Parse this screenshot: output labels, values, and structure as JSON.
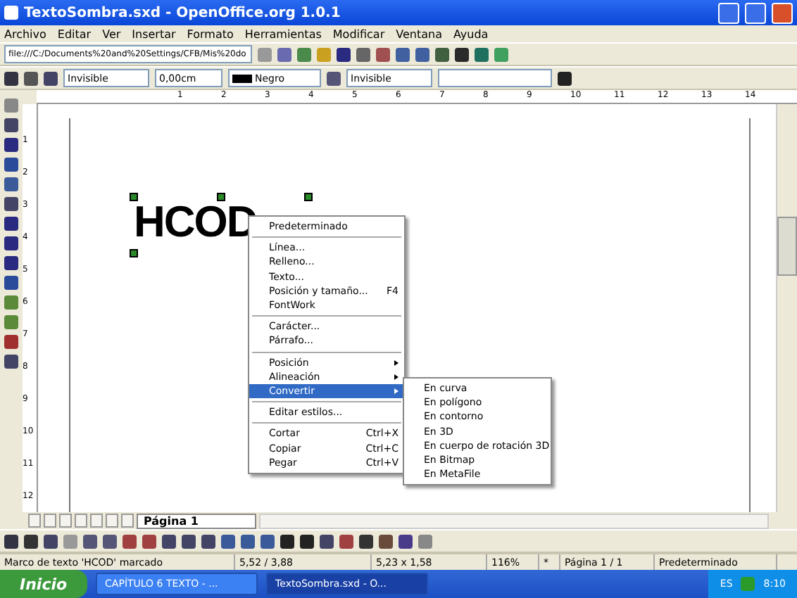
{
  "window": {
    "title": "TextoSombra.sxd - OpenOffice.org 1.0.1"
  },
  "menu": [
    "Archivo",
    "Editar",
    "Ver",
    "Insertar",
    "Formato",
    "Herramientas",
    "Modificar",
    "Ventana",
    "Ayuda"
  ],
  "url_field": {
    "value": "file:///C:/Documents%20and%20Settings/CFB/Mis%20do"
  },
  "line_bar": {
    "line_style": "Invisible",
    "line_width": "0,00cm",
    "line_color": "Negro",
    "area_style": "Invisible"
  },
  "ruler_h": [
    "1",
    "2",
    "3",
    "4",
    "5",
    "6",
    "7",
    "8",
    "9",
    "10",
    "11",
    "12",
    "13",
    "14"
  ],
  "ruler_v": [
    "1",
    "2",
    "3",
    "4",
    "5",
    "6",
    "7",
    "8",
    "9",
    "10",
    "11",
    "12"
  ],
  "drawing_text": "HCOD",
  "context_menu": [
    {
      "kind": "item",
      "label": "Predeterminado",
      "submenu": false,
      "selected": false
    },
    {
      "kind": "separator"
    },
    {
      "kind": "item",
      "label": "Línea...",
      "submenu": false,
      "selected": false
    },
    {
      "kind": "item",
      "label": "Relleno...",
      "submenu": false,
      "selected": false
    },
    {
      "kind": "item",
      "label": "Texto...",
      "submenu": false,
      "selected": false
    },
    {
      "kind": "item",
      "label": "Posición y tamaño...",
      "shortcut": "F4",
      "submenu": false,
      "selected": false
    },
    {
      "kind": "item",
      "label": "FontWork",
      "submenu": false,
      "selected": false
    },
    {
      "kind": "separator"
    },
    {
      "kind": "item",
      "label": "Carácter...",
      "submenu": false,
      "selected": false
    },
    {
      "kind": "item",
      "label": "Párrafo...",
      "submenu": false,
      "selected": false
    },
    {
      "kind": "separator"
    },
    {
      "kind": "item",
      "label": "Posición",
      "submenu": true,
      "selected": false
    },
    {
      "kind": "item",
      "label": "Alineación",
      "submenu": true,
      "selected": false
    },
    {
      "kind": "item",
      "label": "Convertir",
      "submenu": true,
      "selected": true
    },
    {
      "kind": "separator"
    },
    {
      "kind": "item",
      "label": "Editar estilos...",
      "submenu": false,
      "selected": false
    },
    {
      "kind": "separator"
    },
    {
      "kind": "item",
      "label": "Cortar",
      "shortcut": "Ctrl+X",
      "submenu": false,
      "selected": false
    },
    {
      "kind": "item",
      "label": "Copiar",
      "shortcut": "Ctrl+C",
      "submenu": false,
      "selected": false
    },
    {
      "kind": "item",
      "label": "Pegar",
      "shortcut": "Ctrl+V",
      "submenu": false,
      "selected": false
    }
  ],
  "submenu": [
    "En curva",
    "En polígono",
    "En contorno",
    "En 3D",
    "En cuerpo de rotación 3D",
    "En Bitmap",
    "En MetaFile"
  ],
  "page_tabs": [
    {
      "label": "Página 1",
      "selected": true
    }
  ],
  "status_bar": {
    "message": "Marco de texto 'HCOD' marcado",
    "position": "5,52 / 3,88",
    "size": "5,23 x 1,58",
    "zoom": "116%",
    "modified": "*",
    "page": "Página 1 / 1",
    "style": "Predeterminado"
  },
  "taskbar": {
    "start": "Inicio",
    "tasks": [
      {
        "label": "CAPÍTULO 6 TEXTO - ...",
        "selected": false
      },
      {
        "label": "TextoSombra.sxd - O...",
        "selected": true
      }
    ],
    "language": "ES",
    "clock": "8:10"
  }
}
